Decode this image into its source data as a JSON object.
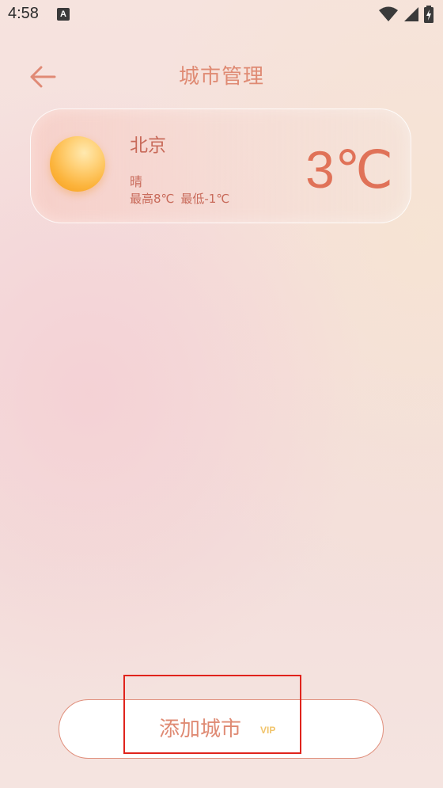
{
  "status_bar": {
    "time": "4:58",
    "notification_icon": "a-accessibility-icon",
    "icons": [
      "wifi-icon",
      "signal-icon",
      "battery-charging-icon"
    ]
  },
  "header": {
    "title": "城市管理",
    "back_icon": "arrow-left-icon"
  },
  "cities": [
    {
      "name": "北京",
      "weather": "晴",
      "weather_icon": "sun-icon",
      "high": "最高8℃",
      "low": "最低-1℃",
      "current_temp": "3℃"
    }
  ],
  "add_city": {
    "label": "添加城市",
    "badge": "VIP"
  },
  "colors": {
    "accent": "#df8a73",
    "temp": "#e07258",
    "vip": "#f1c46b",
    "highlight": "#e0231c"
  }
}
